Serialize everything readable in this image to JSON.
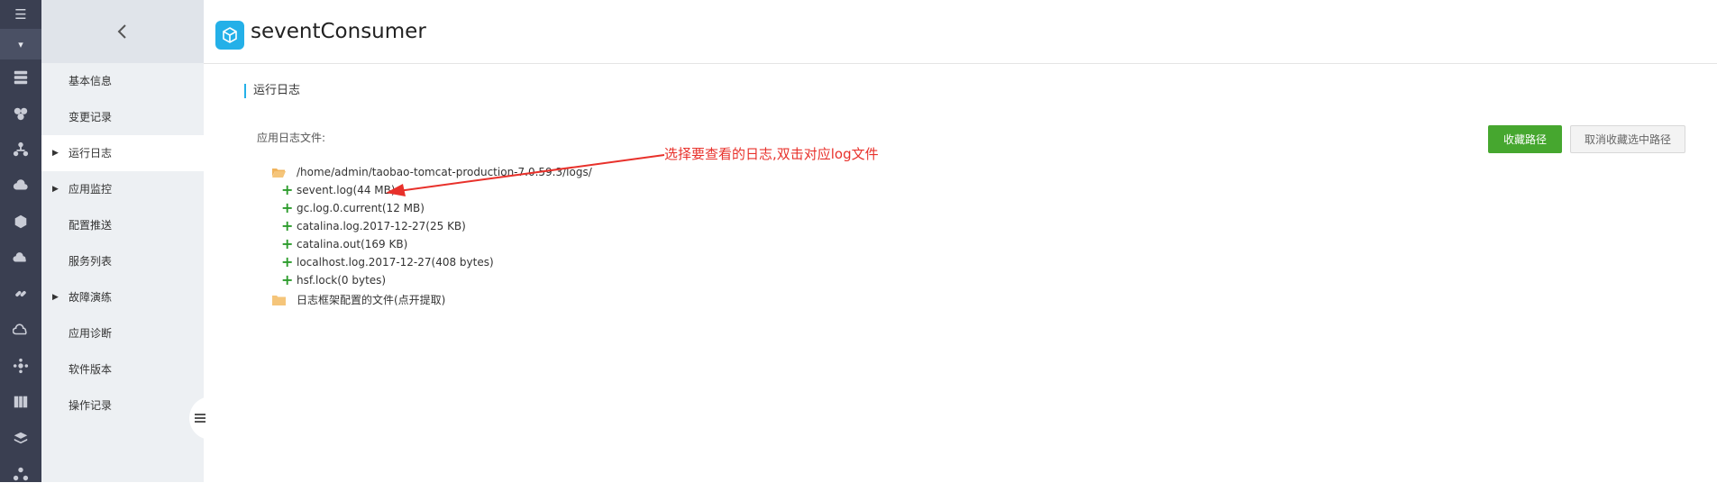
{
  "app": {
    "title": "seventConsumer"
  },
  "rail": {
    "top_icon": "☰",
    "dropdown_icon": "▾",
    "icons": [
      "server-icon",
      "cluster-icon",
      "topology-icon",
      "cloud-upload-icon",
      "cube-icon",
      "cloud-gear-icon",
      "link-icon",
      "cloud-sync-icon",
      "network-icon",
      "book-icon",
      "layers-icon",
      "share-icon"
    ]
  },
  "sidebar": {
    "items": [
      {
        "label": "基本信息",
        "expandable": false
      },
      {
        "label": "变更记录",
        "expandable": false
      },
      {
        "label": "运行日志",
        "expandable": true
      },
      {
        "label": "应用监控",
        "expandable": true
      },
      {
        "label": "配置推送",
        "expandable": false
      },
      {
        "label": "服务列表",
        "expandable": false
      },
      {
        "label": "故障演练",
        "expandable": true
      },
      {
        "label": "应用诊断",
        "expandable": false
      },
      {
        "label": "软件版本",
        "expandable": false
      },
      {
        "label": "操作记录",
        "expandable": false
      }
    ],
    "active_index": 2
  },
  "main": {
    "section_title": "运行日志",
    "files_label": "应用日志文件:",
    "collect_button": "收藏路径",
    "cancel_collect_button": "取消收藏选中路径",
    "tree": {
      "root_path": "/home/admin/taobao-tomcat-production-7.0.59.3/logs/",
      "files": [
        "sevent.log(44 MB)",
        "gc.log.0.current(12 MB)",
        "catalina.log.2017-12-27(25 KB)",
        "catalina.out(169 KB)",
        "localhost.log.2017-12-27(408 bytes)",
        "hsf.lock(0 bytes)"
      ],
      "config_folder": "日志框架配置的文件(点开提取)"
    },
    "annotation": "选择要查看的日志,双击对应log文件"
  },
  "colors": {
    "rail_bg": "#3a3f51",
    "sidebar_bg": "#edf0f3",
    "accent": "#24b0e8",
    "primary_button": "#46a72f",
    "annotation": "#e8312b",
    "folder": "#f5c57a",
    "plus": "#2d9c2d"
  }
}
